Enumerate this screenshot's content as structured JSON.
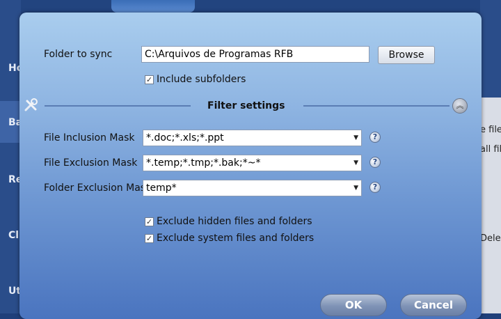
{
  "background": {
    "nav": [
      "Ho",
      "Ba",
      "Re",
      "Cl",
      "Ut"
    ],
    "right_snippets": [
      "e file",
      "all fil",
      "Dele"
    ]
  },
  "dialog": {
    "folder_label": "Folder to sync",
    "folder_value": "C:\\Arquivos de Programas RFB",
    "browse_label": "Browse",
    "include_subfolders_label": "Include subfolders",
    "include_subfolders_checked": true,
    "filter_heading": "Filter settings",
    "filters": [
      {
        "label": "File Inclusion Mask",
        "value": "*.doc;*.xls;*.ppt"
      },
      {
        "label": "File Exclusion Mask",
        "value": "*.temp;*.tmp;*.bak;*~*"
      },
      {
        "label": "Folder Exclusion Mask",
        "value": "temp*"
      }
    ],
    "exclude_hidden_label": "Exclude hidden files and folders",
    "exclude_hidden_checked": true,
    "exclude_system_label": "Exclude system files and folders",
    "exclude_system_checked": true,
    "ok_label": "OK",
    "cancel_label": "Cancel",
    "help_glyph": "?",
    "check_glyph": "✓",
    "combo_arrow_glyph": "▼",
    "collapse_glyph": "︽"
  }
}
